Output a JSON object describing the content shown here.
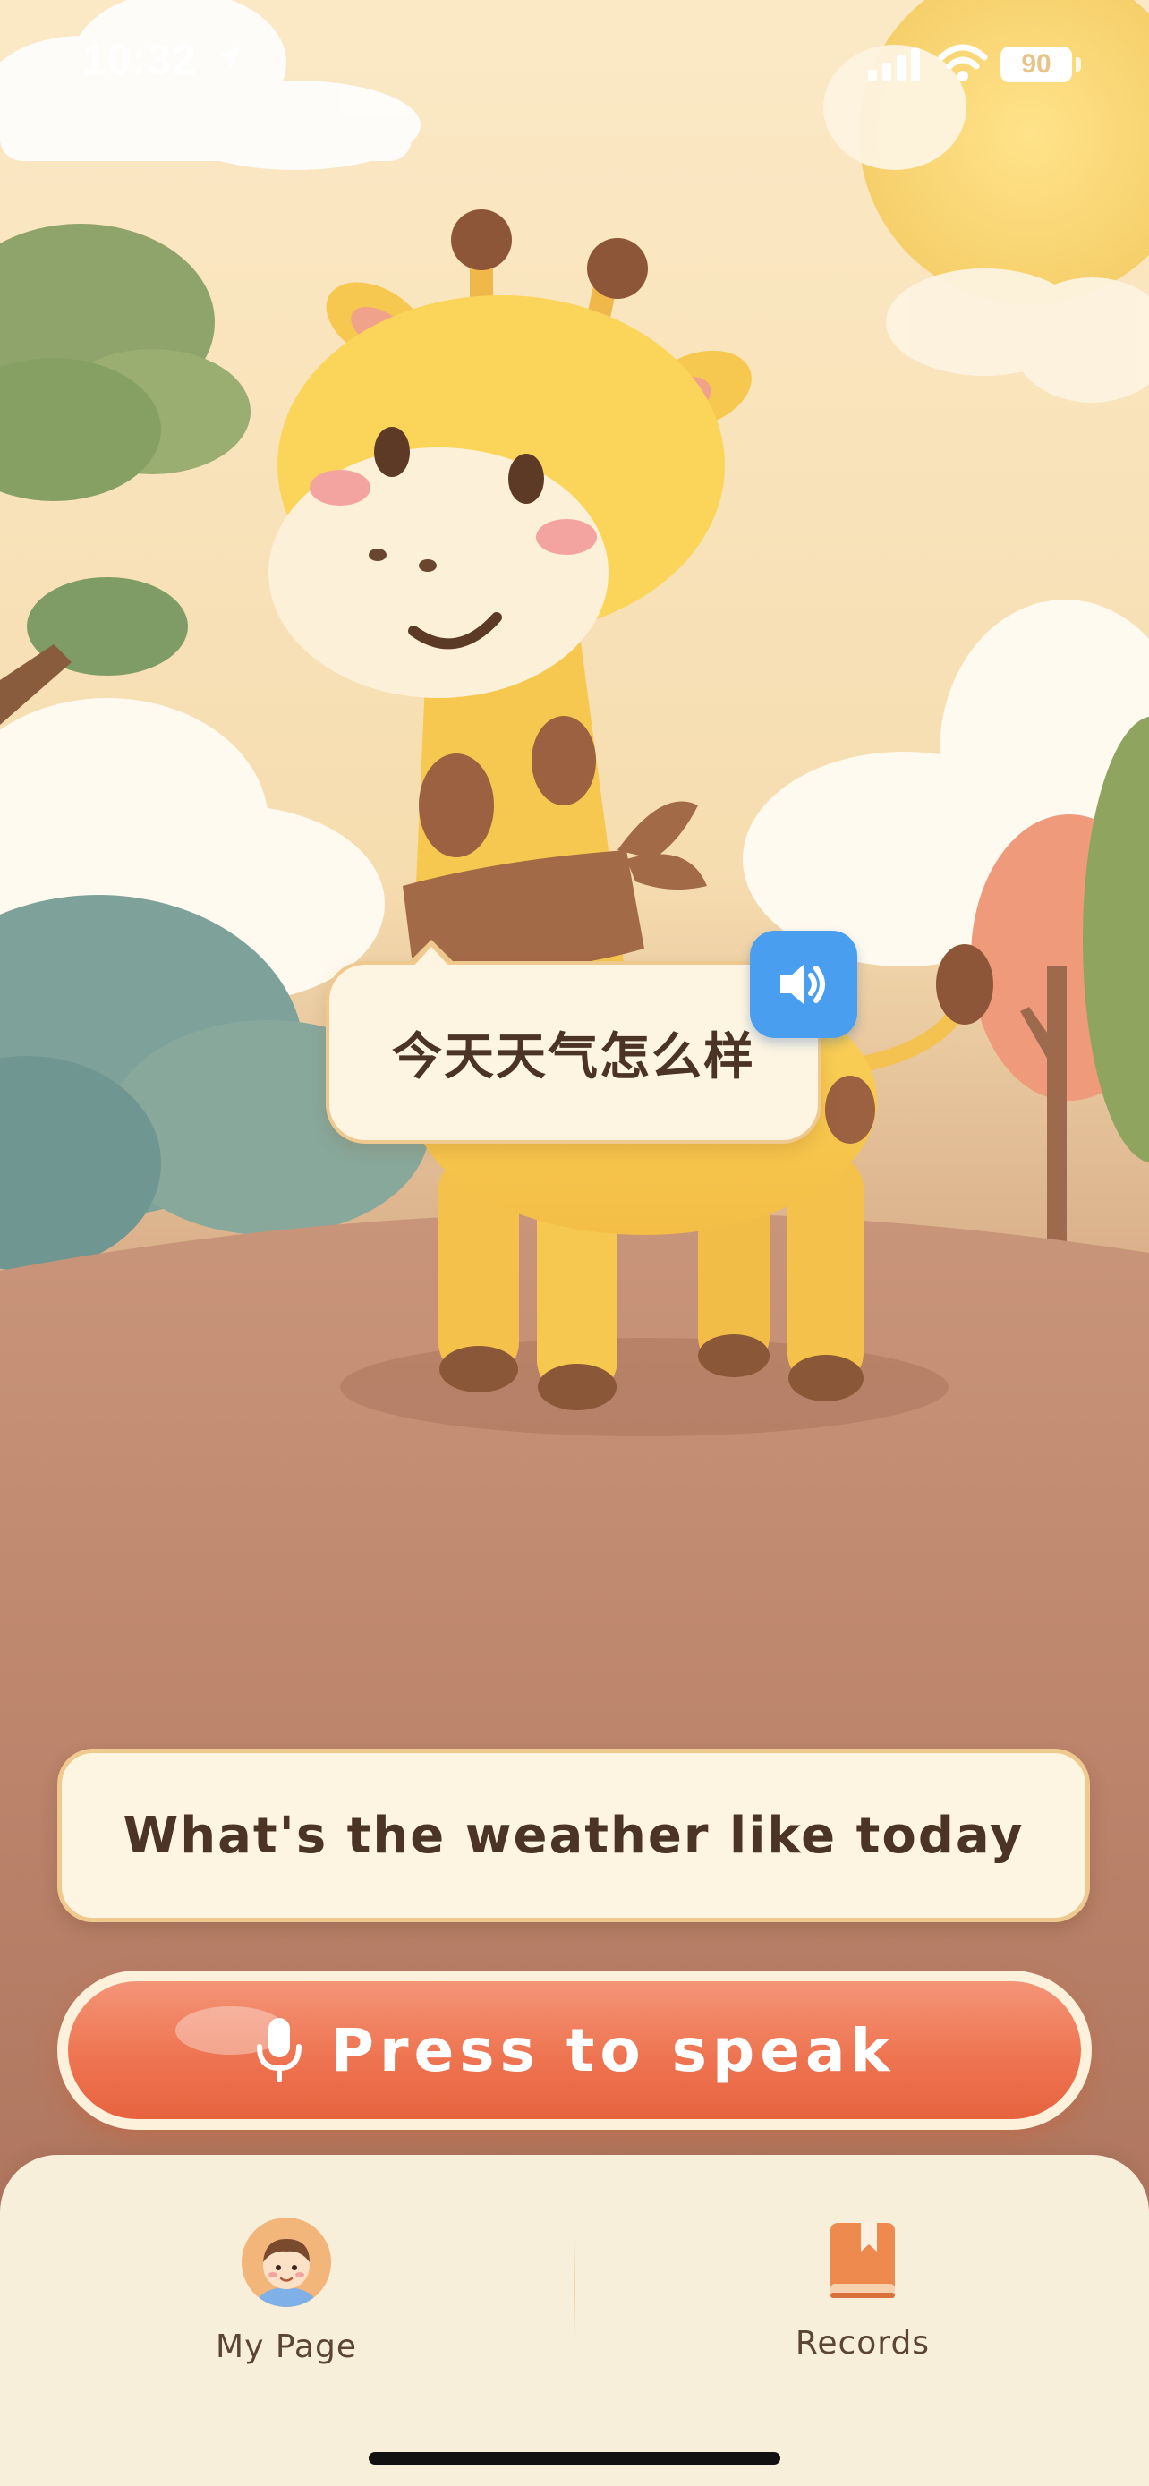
{
  "status_bar": {
    "time": "10:32",
    "battery": "90",
    "icons": [
      "location-arrow-icon",
      "signal-icon",
      "wifi-icon",
      "battery-icon"
    ]
  },
  "scene": {
    "character": "giraffe-illustration"
  },
  "bubble": {
    "text": "今天天气怎么样",
    "speaker_icon": "speaker-icon"
  },
  "translation": {
    "text": "What's the weather like today"
  },
  "speak_button": {
    "label": "Press to speak",
    "icon": "microphone-icon"
  },
  "tabbar": {
    "tabs": [
      {
        "label": "My Page",
        "icon": "avatar-icon"
      },
      {
        "label": "Records",
        "icon": "book-icon"
      }
    ]
  },
  "colors": {
    "accent_orange": "#ee7451",
    "speaker_blue": "#4a9ef0",
    "card_bg": "#fdf5e2",
    "card_border": "#efc98e",
    "text_dark": "#4b3424"
  }
}
